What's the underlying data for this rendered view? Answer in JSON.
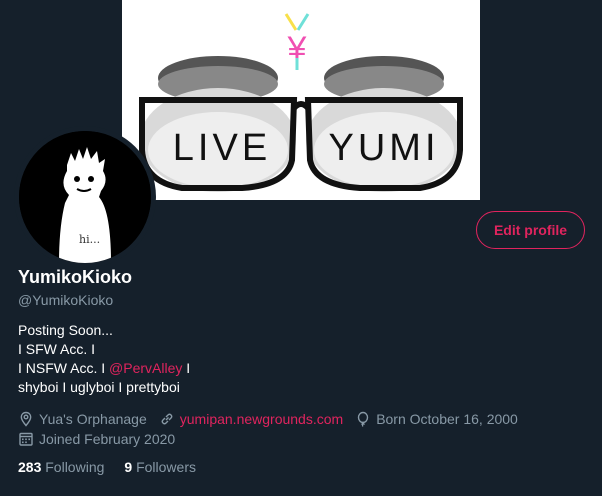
{
  "banner": {
    "left_lens_text": "LIVE",
    "right_lens_text": "YUMI",
    "symbol": "¥"
  },
  "avatar": {
    "caption": "hi..."
  },
  "edit_profile_label": "Edit profile",
  "profile": {
    "display_name": "YumikoKioko",
    "handle": "@YumikoKioko",
    "bio": {
      "line1": "Posting Soon...",
      "line2": "I SFW Acc. I",
      "line3_prefix": "I NSFW Acc. I ",
      "line3_mention": "@PervAlley",
      "line3_suffix": " I",
      "line4": "shyboi I uglyboi I prettyboi"
    },
    "location": "Yua's Orphanage",
    "website": "yumipan.newgrounds.com",
    "birthday": "Born October 16, 2000",
    "joined": "Joined February 2020"
  },
  "stats": {
    "following_count": "283",
    "following_label": "Following",
    "followers_count": "9",
    "followers_label": "Followers"
  },
  "colors": {
    "background": "#15202b",
    "accent": "#e0245e",
    "secondary_text": "#8899a6"
  },
  "icons": {
    "location": "location-pin-icon",
    "website": "link-icon",
    "birthday": "balloon-icon",
    "joined": "calendar-icon"
  }
}
